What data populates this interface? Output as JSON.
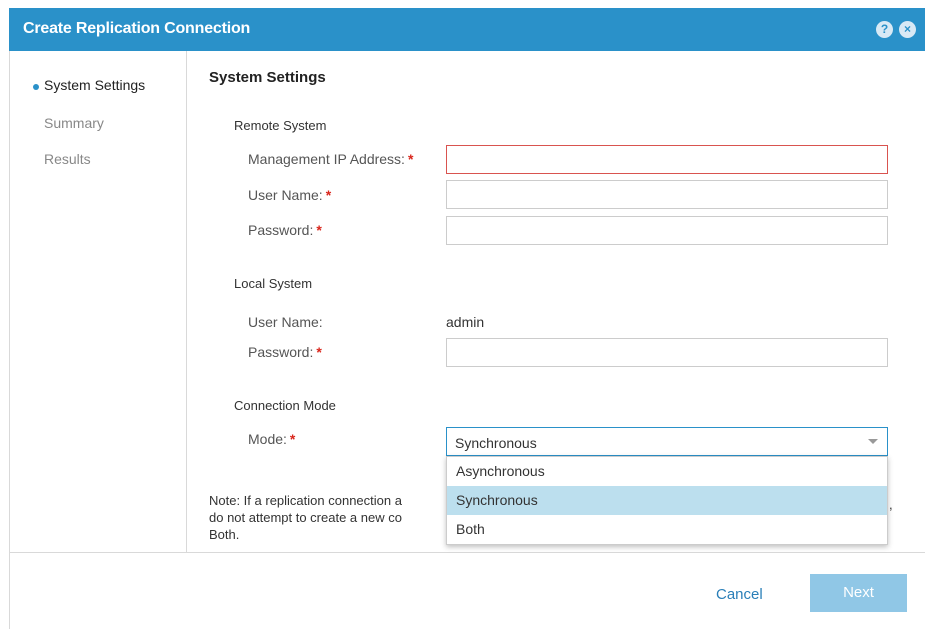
{
  "window": {
    "title": "Create Replication Connection",
    "help_icon": "?",
    "close_icon": "×"
  },
  "sidebar": {
    "steps": [
      {
        "label": "System Settings",
        "active": true
      },
      {
        "label": "Summary",
        "active": false
      },
      {
        "label": "Results",
        "active": false
      }
    ]
  },
  "main": {
    "section_title": "System Settings",
    "remote_system": {
      "heading": "Remote System",
      "mgmt_ip_label": "Management IP Address:",
      "mgmt_ip_value": "",
      "user_name_label": "User Name:",
      "user_name_value": "",
      "password_label": "Password:",
      "password_value": ""
    },
    "local_system": {
      "heading": "Local System",
      "user_name_label": "User Name:",
      "user_name_value": "admin",
      "password_label": "Password:",
      "password_value": ""
    },
    "connection_mode": {
      "heading": "Connection Mode",
      "mode_label": "Mode:",
      "mode_value": "Synchronous",
      "options": [
        "Asynchronous",
        "Synchronous",
        "Both"
      ]
    },
    "required_marker": "*",
    "note": {
      "line1": "Note: If a replication connection a",
      "line2": "do not attempt to create a new co",
      "line3": "Both.",
      "tail": ","
    }
  },
  "footer": {
    "cancel_label": "Cancel",
    "next_label": "Next"
  },
  "colors": {
    "accent": "#2a91c9",
    "required": "#d9261c",
    "error_border": "#d9534f",
    "next_disabled": "#90c7e6",
    "selected_option": "#bcdfee"
  }
}
